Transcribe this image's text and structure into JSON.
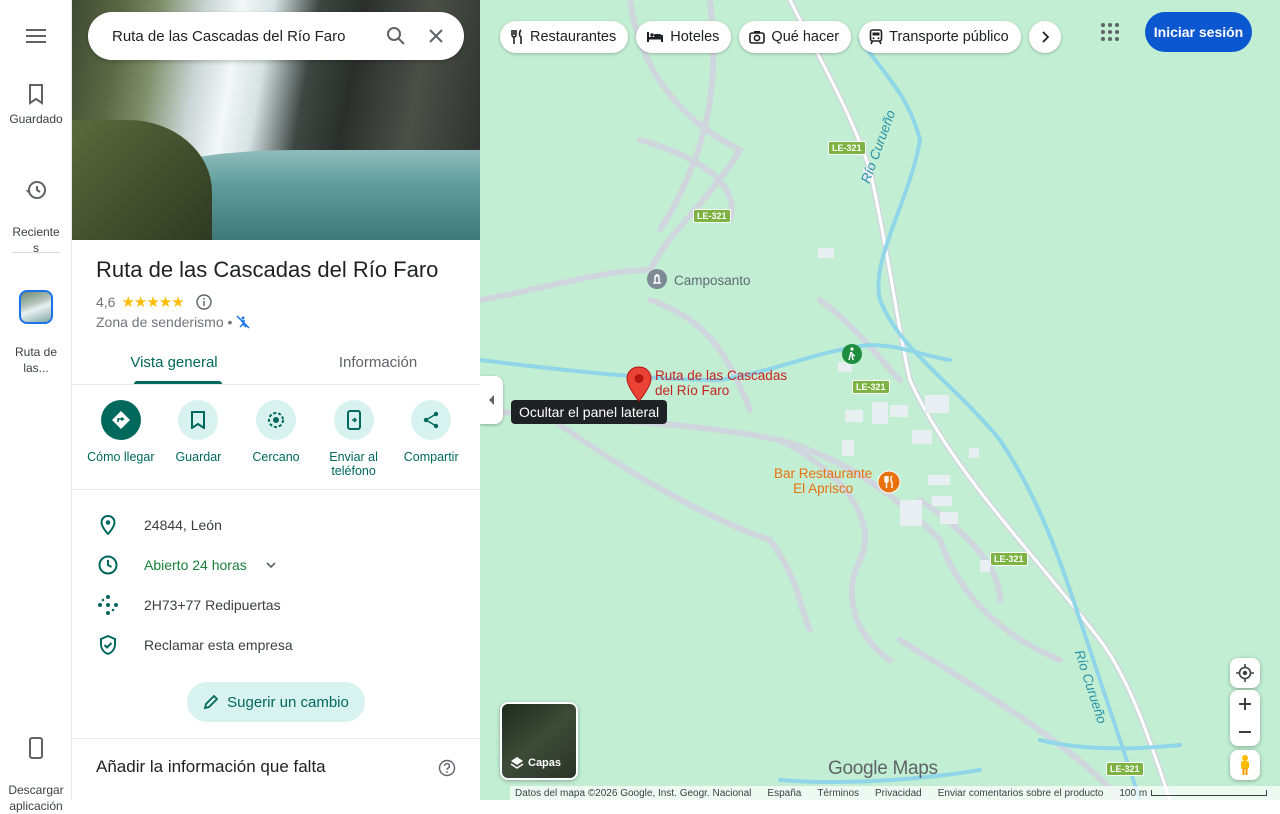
{
  "rail": {
    "saved_label": "Guardado",
    "recent_label": "Reciente\ns",
    "place_label": "Ruta de\nlas...",
    "download_label": "Descargar\naplicación"
  },
  "search": {
    "query": "Ruta de las Cascadas del Río Faro"
  },
  "place": {
    "title": "Ruta de las Cascadas del Río Faro",
    "rating": "4,6",
    "stars": "★★★★★",
    "category": "Zona de senderismo •"
  },
  "tabs": [
    {
      "label": "Vista general"
    },
    {
      "label": "Información"
    }
  ],
  "actions": [
    {
      "label": "Cómo llegar"
    },
    {
      "label": "Guardar"
    },
    {
      "label": "Cercano"
    },
    {
      "label": "Enviar al teléfono"
    },
    {
      "label": "Compartir"
    }
  ],
  "info": {
    "address": "24844, León",
    "hours": "Abierto 24 horas",
    "plus_code": "2H73+77 Redipuertas",
    "claim": "Reclamar esta empresa"
  },
  "suggest_label": "Sugerir un cambio",
  "missing_label": "Añadir la información que falta",
  "map": {
    "chips": [
      "Restaurantes",
      "Hoteles",
      "Qué hacer",
      "Transporte público"
    ],
    "signin_label": "Iniciar sesión",
    "tooltip": "Ocultar el panel lateral",
    "place_marker_label": "Ruta de las Cascadas\ndel Río Faro",
    "cemetery_label": "Camposanto",
    "restaurant_label": "Bar Restaurante\nEl Aprisco",
    "river_label": "Río Curueño",
    "road_label": "LE-321",
    "layers_label": "Capas",
    "brand": "Google Maps",
    "footer": [
      "Datos del mapa ©2026 Google, Inst. Geogr. Nacional",
      "España",
      "Términos",
      "Privacidad",
      "Enviar comentarios sobre el producto",
      "100 m"
    ]
  },
  "colors": {
    "accent": "#00695c",
    "map_bg": "#c2efd4",
    "signin": "#0b57d0",
    "marker": "#ea4335",
    "restaurant": "#e8710a",
    "river": "#2891a6"
  }
}
